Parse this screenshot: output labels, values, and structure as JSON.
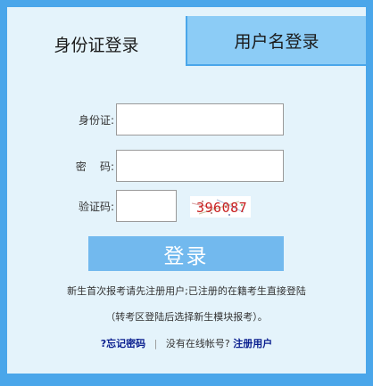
{
  "tabs": [
    {
      "label": "身份证登录",
      "active": true
    },
    {
      "label": "用户名登录",
      "active": false
    }
  ],
  "form": {
    "id_label": "身份证:",
    "id_value": "",
    "password_label": "密    码:",
    "password_value": "",
    "captcha_label": "验证码:",
    "captcha_value": "",
    "captcha_image_text": "396087"
  },
  "login_button": "登录",
  "notes": {
    "line1": "新生首次报考请先注册用户;已注册的在籍考生直接登陆",
    "line2": "（转考区登陆后选择新生模块报考）。"
  },
  "links": {
    "forgot": "?忘记密码",
    "no_account": "没有在线帐号?",
    "register": "注册用户"
  },
  "colors": {
    "frame": "#4aa6ea",
    "panel": "#e4f3fb",
    "inactive_tab": "#8cccf6",
    "button": "#72b9ee",
    "link": "#0a1f8f",
    "captcha_text": "#c81e1e"
  }
}
